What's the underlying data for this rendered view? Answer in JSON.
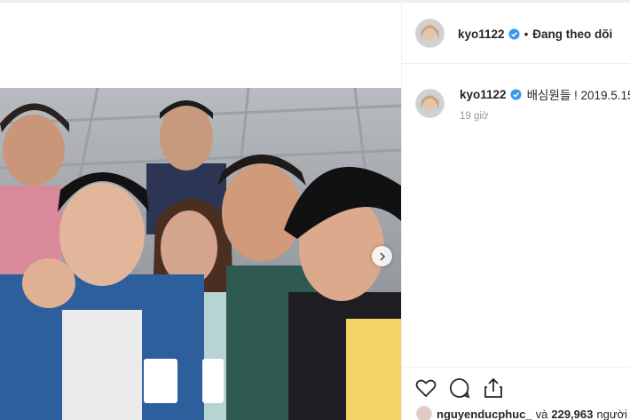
{
  "post": {
    "author": "kyo1122",
    "follow_state": "Đang theo dõi",
    "separator": "•",
    "caption": "배심원들 ! 2019.5.15",
    "time_ago": "19 giờ",
    "liked_by": "nguyenducphuc_",
    "and_text": "và",
    "likes_count": "229,963",
    "likes_suffix": "người t"
  },
  "colors": {
    "verified_blue": "#3897f0",
    "text": "#262626",
    "muted": "#999999",
    "border": "#efefef"
  },
  "icons": {
    "verified": "verified-badge-icon",
    "like": "heart-icon",
    "comment": "comment-bubble-icon",
    "share": "share-icon",
    "next": "chevron-right-icon"
  }
}
